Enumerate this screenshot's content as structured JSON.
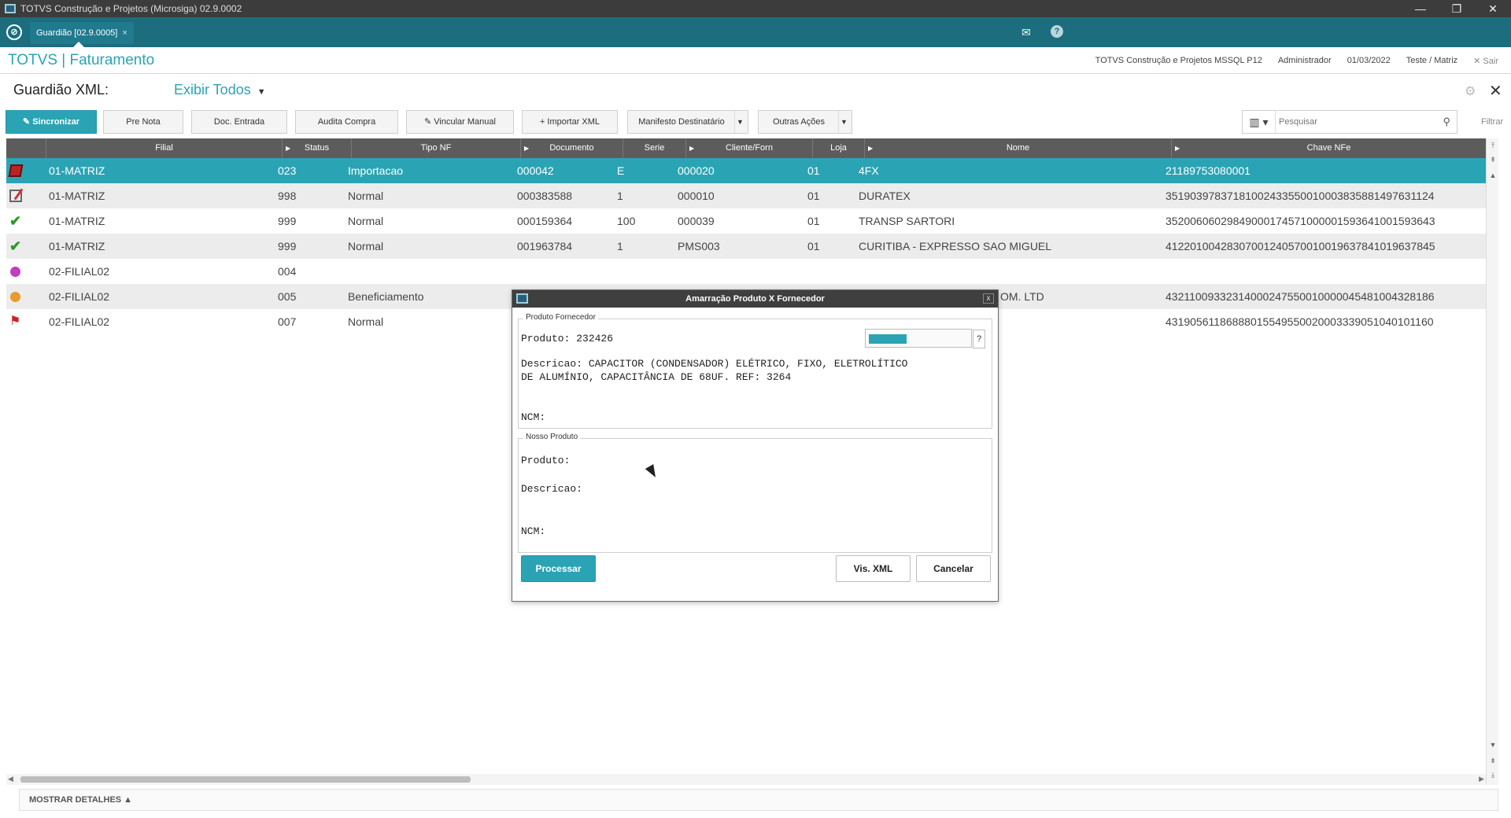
{
  "window": {
    "title": "TOTVS Construção e Projetos (Microsiga) 02.9.0002",
    "minimize": "—",
    "restore": "❐",
    "close": "✕"
  },
  "tabbar": {
    "tab_label": "Guardião [02.9.0005]",
    "tab_close": "×",
    "mail_icon": "✉",
    "help_icon": "?"
  },
  "module": {
    "brand": "TOTVS | Faturamento",
    "environment": "TOTVS Construção e Projetos MSSQL P12",
    "user": "Administrador",
    "date": "01/03/2022",
    "branch": "Teste / Matriz",
    "exit": "✕  Sair"
  },
  "page": {
    "title": "Guardião XML:",
    "filter": "Exibir Todos",
    "filter_caret": "▼"
  },
  "toolbar": {
    "sincronizar": "Sincronizar",
    "pre_nota": "Pre Nota",
    "doc_entrada": "Doc. Entrada",
    "audita_compra": "Audita Compra",
    "vincular_manual": "Vincular Manual",
    "importar_xml": "Importar XML",
    "manifesto": "Manifesto Destinatário",
    "outras_acoes": "Outras Ações",
    "search_placeholder": "Pesquisar",
    "filtrar": "Filtrar"
  },
  "grid": {
    "columns": [
      "Filial",
      "Status",
      "Tipo NF",
      "Documento",
      "Serie",
      "Cliente/Forn",
      "Loja",
      "Nome",
      "Chave NFe"
    ],
    "rows": [
      {
        "icon": "box-icon",
        "filial": "01-MATRIZ",
        "status": "023",
        "tipo": "Importacao",
        "doc": "000042",
        "serie": "E",
        "cliente": "000020",
        "loja": "01",
        "nome": "4FX",
        "chave": "21189753080001"
      },
      {
        "icon": "edit-icon",
        "filial": "01-MATRIZ",
        "status": "998",
        "tipo": "Normal",
        "doc": "000383588",
        "serie": "1",
        "cliente": "000010",
        "loja": "01",
        "nome": "DURATEX",
        "chave": "35190397837181002433550010003835881497631124"
      },
      {
        "icon": "check-icon",
        "filial": "01-MATRIZ",
        "status": "999",
        "tipo": "Normal",
        "doc": "000159364",
        "serie": "100",
        "cliente": "000039",
        "loja": "01",
        "nome": "TRANSP SARTORI",
        "chave": "35200606029849000174571000001593641001593643"
      },
      {
        "icon": "check-icon",
        "filial": "01-MATRIZ",
        "status": "999",
        "tipo": "Normal",
        "doc": "001963784",
        "serie": "1",
        "cliente": "PMS003",
        "loja": "01",
        "nome": "CURITIBA - EXPRESSO SAO MIGUEL",
        "chave": "41220100428307001240570010019637841019637845"
      },
      {
        "icon": "pink-dot-icon",
        "filial": "02-FILIAL02",
        "status": "004",
        "tipo": "",
        "doc": "",
        "serie": "",
        "cliente": "",
        "loja": "",
        "nome": "",
        "chave": ""
      },
      {
        "icon": "orange-dot-icon",
        "filial": "02-FILIAL02",
        "status": "005",
        "tipo": "Beneficiamento",
        "doc": "",
        "serie": "",
        "cliente": "",
        "loja": "",
        "nome": "OM. LTD",
        "chave": "43211009332314000247550010000045481004328186"
      },
      {
        "icon": "flag-icon",
        "filial": "02-FILIAL02",
        "status": "007",
        "tipo": "Normal",
        "doc": "",
        "serie": "",
        "cliente": "",
        "loja": "",
        "nome": "",
        "chave": "43190561186888015549550020003339051040101160"
      }
    ]
  },
  "footer": {
    "mostrar_detalhes": "MOSTRAR DETALHES  ▲"
  },
  "dialog": {
    "title": "Amarração Produto X Fornecedor",
    "close": "x",
    "fornecedor_legend": "Produto Fornecedor",
    "fornecedor_produto": "Produto: 232426",
    "fornecedor_descricao_1": "Descricao: CAPACITOR (CONDENSADOR) ELÉTRICO, FIXO, ELETROLÍTICO",
    "fornecedor_descricao_2": "DE ALUMÍNIO, CAPACITÂNCIA DE 68UF. REF: 3264",
    "fornecedor_ncm": "NCM:",
    "lookup_help": "?",
    "nosso_legend": "Nosso Produto",
    "nosso_produto": "Produto:",
    "nosso_descricao": "Descricao:",
    "nosso_ncm": "NCM:",
    "processar": "Processar",
    "vis_xml": "Vis. XML",
    "cancelar": "Cancelar"
  }
}
